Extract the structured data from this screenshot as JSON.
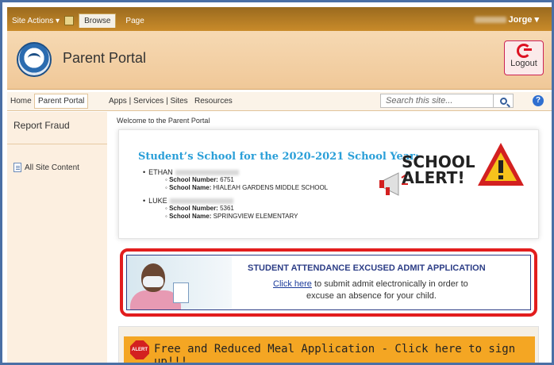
{
  "ribbon": {
    "site_actions": "Site Actions ▾",
    "browse_tab": "Browse",
    "page_tab": "Page",
    "user_menu": "Jorge ▾"
  },
  "header": {
    "site_title": "Parent Portal",
    "logout_label": "Logout"
  },
  "nav": {
    "items": [
      "Home",
      "Parent Portal",
      "Apps | Services | Sites",
      "Resources"
    ],
    "search_placeholder": "Search this site..."
  },
  "sidebar": {
    "report_fraud": "Report Fraud",
    "all_site_content": "All Site Content"
  },
  "main": {
    "welcome": "Welcome to the Parent Portal",
    "school_heading": "Student’s School for the 2020-2021 School Year:",
    "students": [
      {
        "name": "ETHAN",
        "number_label": "School Number:",
        "number": "6751",
        "school_label": "School Name:",
        "school": "HIALEAH GARDENS MIDDLE SCHOOL"
      },
      {
        "name": "LUKE",
        "number_label": "School Number:",
        "number": "5361",
        "school_label": "School Name:",
        "school": "SPRINGVIEW ELEMENTARY"
      }
    ],
    "alert_text": "SCHOOL ALERT!",
    "attendance": {
      "title": "STUDENT ATTENDANCE EXCUSED ADMIT APPLICATION",
      "click_here": "Click here",
      "line1_rest": " to submit admit electronically in order to",
      "line2": "excuse an absence for your child."
    },
    "meal_banner": "Free and Reduced Meal Application - Click here to sign up!!!",
    "stop_sign_text": "ALERT"
  },
  "colors": {
    "topbar": "#c98b2a",
    "header": "#f0c898",
    "heading_blue": "#2a9fd8",
    "alert_red": "#e21d1d",
    "meal_orange": "#f4a623"
  }
}
